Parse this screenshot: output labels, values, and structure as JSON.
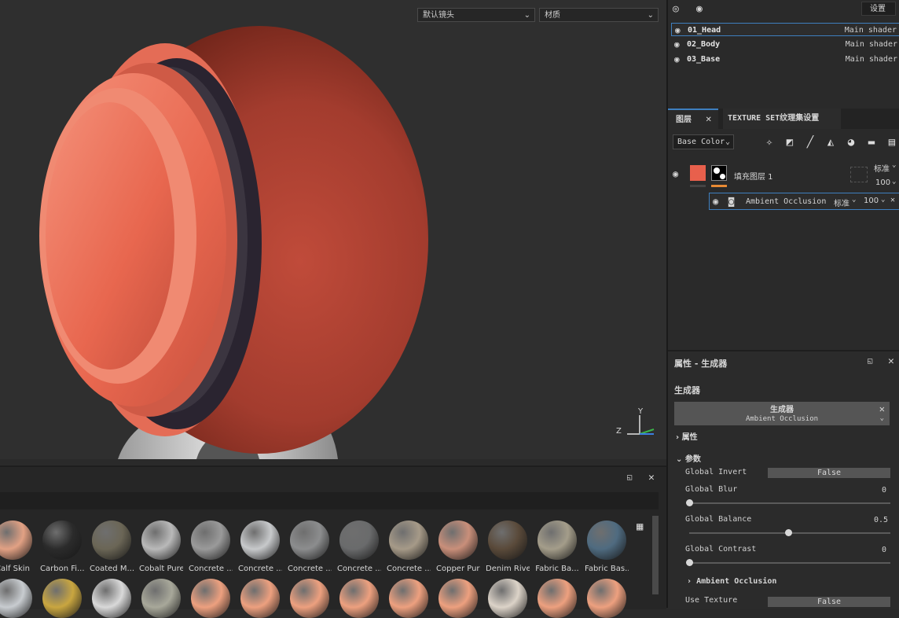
{
  "viewport": {
    "camera_select": "默认镜头",
    "material_select": "材质",
    "axis": {
      "y": "Y",
      "z": "Z"
    }
  },
  "header": {
    "settings_label": "设置"
  },
  "texture_sets": [
    {
      "name": "01_Head",
      "shader": "Main shader",
      "active": true
    },
    {
      "name": "02_Body",
      "shader": "Main shader",
      "active": false
    },
    {
      "name": "03_Base",
      "shader": "Main shader",
      "active": false
    }
  ],
  "layers_panel": {
    "tab_layers": "图层",
    "tab_texture_set": "TEXTURE SET纹理集设置",
    "channel_select": "Base Color",
    "layer": {
      "name": "填充图层 1",
      "blend": "标准",
      "opacity": "100",
      "color": "#e8604c"
    },
    "effect": {
      "name": "Ambient Occlusion",
      "blend": "标准",
      "opacity": "100"
    }
  },
  "properties": {
    "title": "属性 - 生成器",
    "section": "生成器",
    "generator_title": "生成器",
    "generator_name": "Ambient Occlusion",
    "group_attributes": "属性",
    "group_params": "参数",
    "global_invert_label": "Global Invert",
    "global_invert_value": "False",
    "global_blur_label": "Global Blur",
    "global_blur_value": "0",
    "global_balance_label": "Global Balance",
    "global_balance_value": "0.5",
    "global_contrast_label": "Global Contrast",
    "global_contrast_value": "0",
    "ao_group": "Ambient Occlusion",
    "use_texture_label": "Use Texture",
    "use_texture_value": "False"
  },
  "shelf": {
    "materials_row1": [
      {
        "label": "Calf Skin",
        "color": "#e2a184"
      },
      {
        "label": "Carbon Fi...",
        "color": "#2b2b2b"
      },
      {
        "label": "Coated M...",
        "color": "#6b6656"
      },
      {
        "label": "Cobalt Pure",
        "color": "#b9b9b9"
      },
      {
        "label": "Concrete ...",
        "color": "#9a9a9a"
      },
      {
        "label": "Concrete ...",
        "color": "#c7c9cb"
      },
      {
        "label": "Concrete ...",
        "color": "#8c8d8e"
      },
      {
        "label": "Concrete ...",
        "color": "#6a6b6c"
      },
      {
        "label": "Concrete ...",
        "color": "#a69a88"
      },
      {
        "label": "Copper Pure",
        "color": "#c98f7a"
      },
      {
        "label": "Denim Rivet",
        "color": "#5a4a3a"
      },
      {
        "label": "Fabric Ba...",
        "color": "#a49d8a"
      },
      {
        "label": "Fabric Bas...",
        "color": "#4f6b80"
      }
    ],
    "materials_row2": [
      {
        "color": "#c8ccd0"
      },
      {
        "color": "#c9a640"
      },
      {
        "color": "#d9d9d9"
      },
      {
        "color": "#a8a89a"
      },
      {
        "color": "#eda07f"
      },
      {
        "color": "#eda07f"
      },
      {
        "color": "#eda07f"
      },
      {
        "color": "#eda07f"
      },
      {
        "color": "#eda07f"
      },
      {
        "color": "#eda07f"
      },
      {
        "color": "#dcd3c8"
      },
      {
        "color": "#eda07f"
      },
      {
        "color": "#eda07f"
      }
    ]
  },
  "colors": {
    "accent": "#3e7fbf",
    "head_red": "#d8604e"
  }
}
